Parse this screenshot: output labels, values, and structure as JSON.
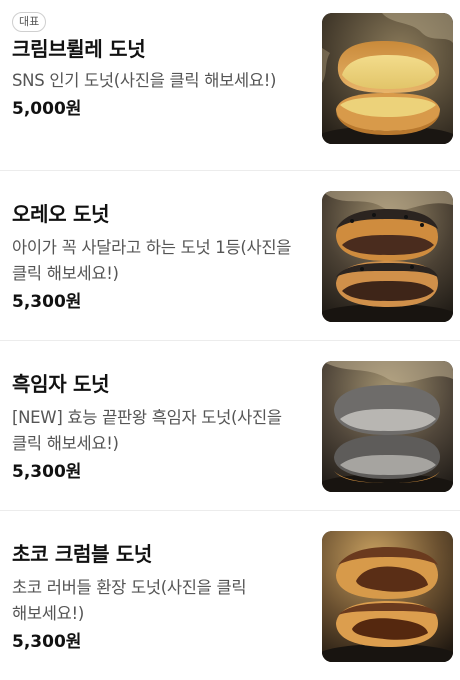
{
  "menu": {
    "items": [
      {
        "badge": "대표",
        "name": "크림브륄레 도넛",
        "description": "SNS 인기 도넛(사진을 클릭 해보세요!)",
        "price": "5,000원",
        "image_icon": "cream-brulee-donut-photo"
      },
      {
        "name": "오레오 도넛",
        "description": "아이가 꼭 사달라고 하는 도넛 1등(사진을 클릭 해보세요!)",
        "price": "5,300원",
        "image_icon": "oreo-donut-photo"
      },
      {
        "name": "흑임자 도넛",
        "description": "[NEW] 효능 끝판왕 흑임자 도넛(사진을 클릭 해보세요!)",
        "price": "5,300원",
        "image_icon": "black-sesame-donut-photo"
      },
      {
        "name": "초코 크럼블 도넛",
        "description": "초코 러버들 환장 도넛(사진을 클릭 해보세요!)",
        "price": "5,300원",
        "image_icon": "choco-crumble-donut-photo"
      }
    ]
  }
}
